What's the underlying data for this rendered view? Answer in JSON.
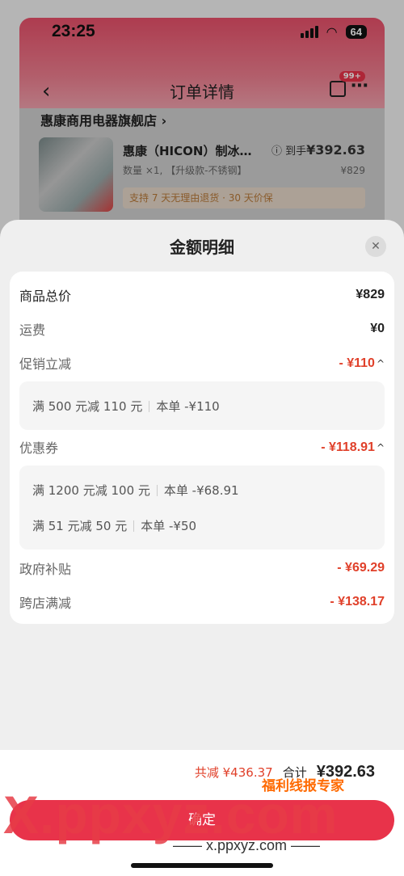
{
  "status_bar": {
    "time": "23:25",
    "battery": "64"
  },
  "nav": {
    "title": "订单详情",
    "badge": "99+"
  },
  "order": {
    "shop_name": "惠康商用电器旗舰店 ›",
    "product_title": "惠康（HICON）制冰…",
    "product_spec": "数量 ×1, 【升级款-不锈钢】",
    "price_prefix": "到手",
    "price": "¥392.63",
    "original_price": "¥829",
    "return_tip": "支持 7 天无理由退货 · 30 天价保"
  },
  "sheet": {
    "title": "金额明细",
    "rows": [
      {
        "label": "商品总价",
        "value": "¥829"
      },
      {
        "label": "运费",
        "value": "¥0"
      },
      {
        "label": "促销立减",
        "value": "- ¥110"
      },
      {
        "label": "优惠券",
        "value": "- ¥118.91"
      },
      {
        "label": "政府补贴",
        "value": "- ¥69.29"
      },
      {
        "label": "跨店满减",
        "value": "- ¥138.17"
      }
    ],
    "promo_items": [
      {
        "rule": "满 500 元减 110 元",
        "amount": "本单 -¥110"
      }
    ],
    "coupon_items": [
      {
        "rule": "满 1200 元减 100 元",
        "amount": "本单 -¥68.91"
      },
      {
        "rule": "满 51 元减 50 元",
        "amount": "本单 -¥50"
      }
    ]
  },
  "bottom": {
    "saved": "共减 ¥436.37",
    "total_label": "合计",
    "total": "¥392.63",
    "confirm": "确定"
  },
  "watermark": {
    "big": "X.ppxyz.com",
    "site": "—— x.ppxyz.com ——",
    "brand": "福利线报专家"
  },
  "colors": {
    "accent": "#e8334a",
    "discount": "#e0402a"
  }
}
